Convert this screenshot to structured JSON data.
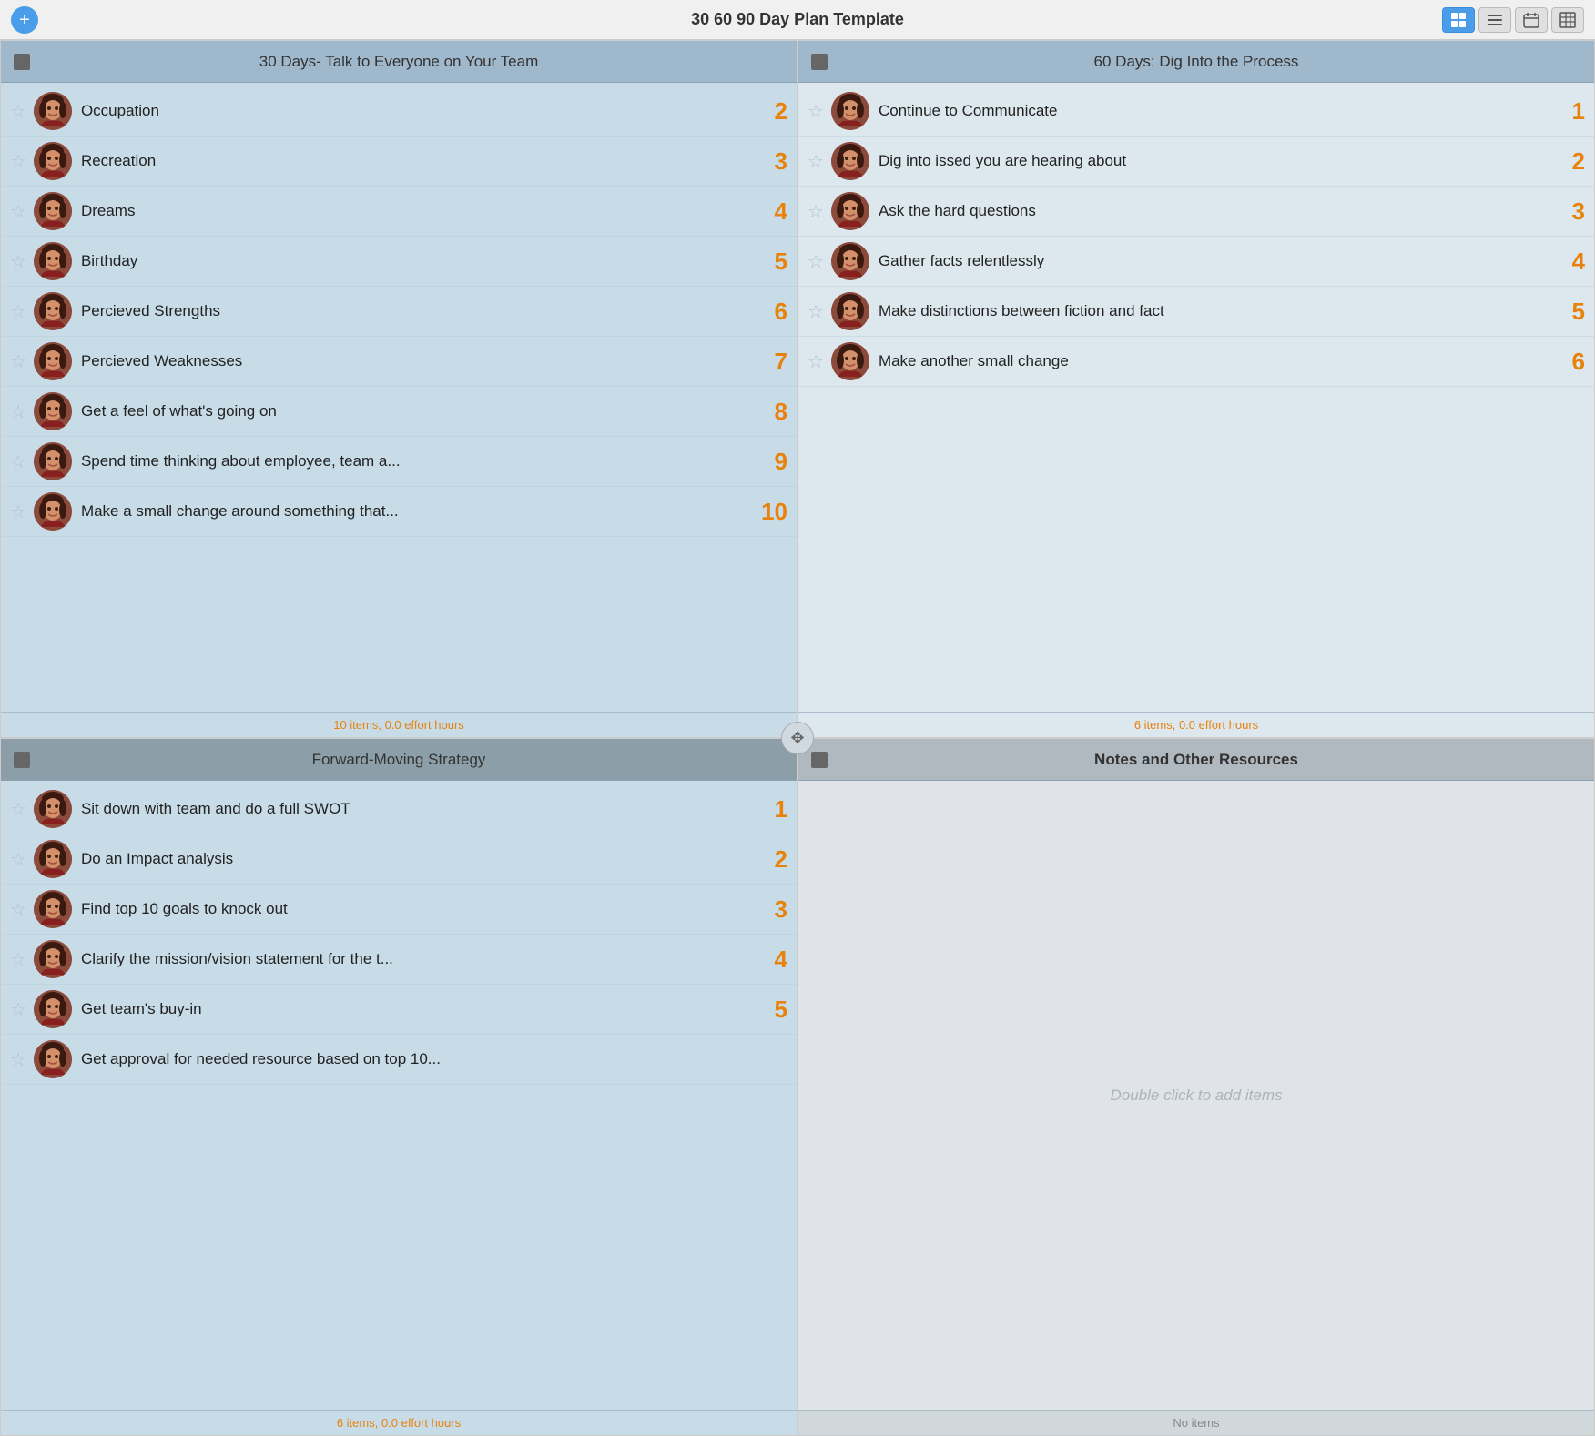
{
  "app": {
    "title": "30 60 90 Day Plan Template",
    "add_button": "+",
    "view_buttons": [
      "grid",
      "list",
      "calendar",
      "table"
    ]
  },
  "quadrants": {
    "q1": {
      "title": "30 Days- Talk to Everyone on Your Team",
      "items": [
        {
          "text": "Occupation",
          "number": "2"
        },
        {
          "text": "Recreation",
          "number": "3"
        },
        {
          "text": "Dreams",
          "number": "4"
        },
        {
          "text": "Birthday",
          "number": "5"
        },
        {
          "text": "Percieved Strengths",
          "number": "6"
        },
        {
          "text": "Percieved Weaknesses",
          "number": "7"
        },
        {
          "text": "Get a feel of what's going on",
          "number": "8"
        },
        {
          "text": "Spend time thinking about employee, team a...",
          "number": "9"
        },
        {
          "text": "Make a small change around something that...",
          "number": "10"
        }
      ],
      "footer": "10 items, 0.0 effort hours"
    },
    "q2": {
      "title": "60 Days: Dig Into the Process",
      "items": [
        {
          "text": "Continue to Communicate",
          "number": "1"
        },
        {
          "text": "Dig into issed you are hearing about",
          "number": "2"
        },
        {
          "text": "Ask the hard questions",
          "number": "3"
        },
        {
          "text": "Gather facts relentlessly",
          "number": "4"
        },
        {
          "text": "Make distinctions between fiction and fact",
          "number": "5"
        },
        {
          "text": "Make another small change",
          "number": "6"
        }
      ],
      "footer": "6 items, 0.0 effort hours"
    },
    "q3": {
      "title": "Forward-Moving Strategy",
      "items": [
        {
          "text": "Sit down with team and do a full SWOT",
          "number": "1"
        },
        {
          "text": "Do an Impact analysis",
          "number": "2"
        },
        {
          "text": "Find top 10 goals to knock out",
          "number": "3"
        },
        {
          "text": "Clarify the mission/vision statement for the t...",
          "number": "4"
        },
        {
          "text": "Get team's buy-in",
          "number": "5"
        },
        {
          "text": "Get approval for needed resource based on top 10...",
          "number": ""
        }
      ],
      "footer": "6 items, 0.0 effort hours"
    },
    "q4": {
      "title": "Notes and Other Resources",
      "items": [],
      "empty_hint": "Double click to add items",
      "footer": "No items"
    }
  },
  "drag_icon": "✥"
}
